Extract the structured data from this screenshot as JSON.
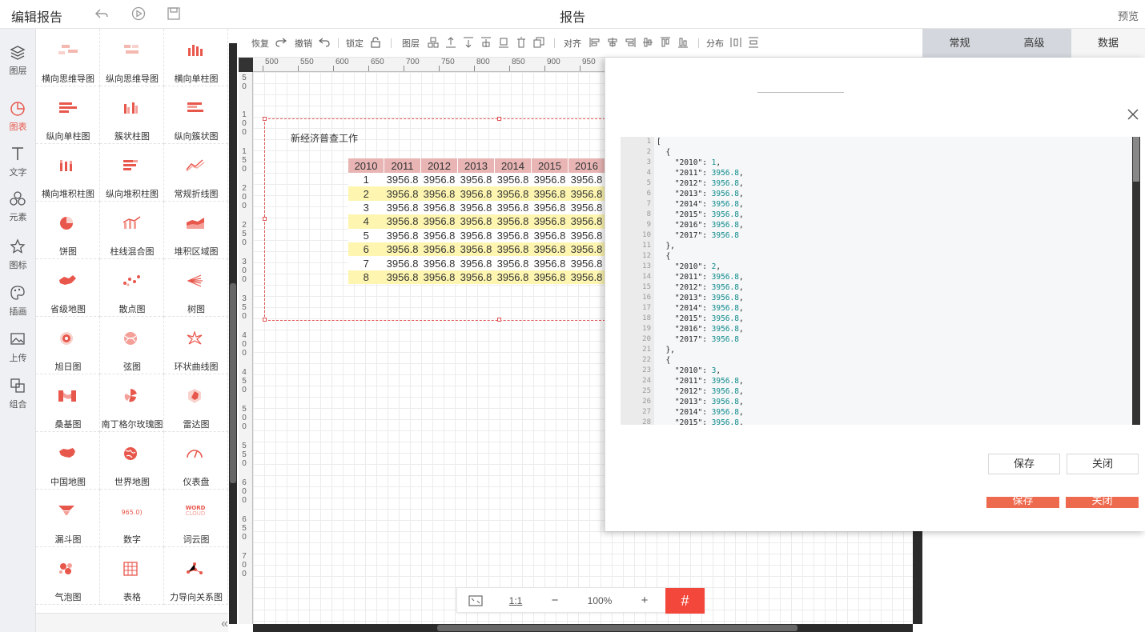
{
  "header": {
    "title": "编辑报告",
    "center_title": "报告",
    "preview_label": "预览"
  },
  "leftnav": [
    {
      "label": "图层",
      "icon": "layers-icon"
    },
    {
      "label": "图表",
      "icon": "chart-pie-icon"
    },
    {
      "label": "文字",
      "icon": "text-icon"
    },
    {
      "label": "元素",
      "icon": "elements-icon"
    },
    {
      "label": "图标",
      "icon": "star-icon"
    },
    {
      "label": "插画",
      "icon": "palette-icon"
    },
    {
      "label": "上传",
      "icon": "upload-image-icon"
    },
    {
      "label": "组合",
      "icon": "group-icon"
    }
  ],
  "palette": [
    "横向思维导图",
    "纵向思维导图",
    "横向单柱图",
    "纵向单柱图",
    "簇状柱图",
    "纵向簇状图",
    "横向堆积柱图",
    "纵向堆积柱图",
    "常规折线图",
    "饼图",
    "柱线混合图",
    "堆积区域图",
    "省级地图",
    "散点图",
    "树图",
    "旭日图",
    "弦图",
    "环状曲线图",
    "桑基图",
    "南丁格尔玫瑰图",
    "雷达图",
    "中国地图",
    "世界地图",
    "仪表盘",
    "漏斗图",
    "数字",
    "词云图",
    "气泡图",
    "表格",
    "力导向关系图"
  ],
  "toolbar": {
    "redo": "恢复",
    "undo": "撤销",
    "lock": "锁定",
    "layer": "图层",
    "align": "对齐",
    "distribute": "分布"
  },
  "ruler": {
    "top": [
      "500",
      "550",
      "600",
      "650",
      "700",
      "750",
      "800",
      "850",
      "900",
      "950"
    ],
    "left": [
      "50",
      "100",
      "150",
      "200",
      "250",
      "300",
      "350",
      "400",
      "450",
      "500",
      "550",
      "600",
      "650",
      "700"
    ]
  },
  "widget": {
    "title": "新经济普查工作",
    "columns": [
      "2010",
      "2011",
      "2012",
      "2013",
      "2014",
      "2015",
      "2016"
    ],
    "rows": [
      [
        "1",
        "3956.8",
        "3956.8",
        "3956.8",
        "3956.8",
        "3956.8",
        "3956.8"
      ],
      [
        "2",
        "3956.8",
        "3956.8",
        "3956.8",
        "3956.8",
        "3956.8",
        "3956.8"
      ],
      [
        "3",
        "3956.8",
        "3956.8",
        "3956.8",
        "3956.8",
        "3956.8",
        "3956.8"
      ],
      [
        "4",
        "3956.8",
        "3956.8",
        "3956.8",
        "3956.8",
        "3956.8",
        "3956.8"
      ],
      [
        "5",
        "3956.8",
        "3956.8",
        "3956.8",
        "3956.8",
        "3956.8",
        "3956.8"
      ],
      [
        "6",
        "3956.8",
        "3956.8",
        "3956.8",
        "3956.8",
        "3956.8",
        "3956.8"
      ],
      [
        "7",
        "3956.8",
        "3956.8",
        "3956.8",
        "3956.8",
        "3956.8",
        "3956.8"
      ],
      [
        "8",
        "3956.8",
        "3956.8",
        "3956.8",
        "3956.8",
        "3956.8",
        "3956.8"
      ]
    ]
  },
  "zoombar": {
    "ratio": "1:1",
    "minus": "−",
    "zoom": "100%",
    "plus": "+"
  },
  "right_tabs": [
    {
      "label": "常规"
    },
    {
      "label": "高级"
    },
    {
      "label": "数据"
    }
  ],
  "editor": {
    "lines": [
      [
        "1",
        "["
      ],
      [
        "2",
        "  {"
      ],
      [
        "3",
        "    \"2010\": ",
        "1",
        ","
      ],
      [
        "4",
        "    \"2011\": ",
        "3956.8",
        ","
      ],
      [
        "5",
        "    \"2012\": ",
        "3956.8",
        ","
      ],
      [
        "6",
        "    \"2013\": ",
        "3956.8",
        ","
      ],
      [
        "7",
        "    \"2014\": ",
        "3956.8",
        ","
      ],
      [
        "8",
        "    \"2015\": ",
        "3956.8",
        ","
      ],
      [
        "9",
        "    \"2016\": ",
        "3956.8",
        ","
      ],
      [
        "10",
        "    \"2017\": ",
        "3956.8",
        ""
      ],
      [
        "11",
        "  },"
      ],
      [
        "12",
        "  {"
      ],
      [
        "13",
        "    \"2010\": ",
        "2",
        ","
      ],
      [
        "14",
        "    \"2011\": ",
        "3956.8",
        ","
      ],
      [
        "15",
        "    \"2012\": ",
        "3956.8",
        ","
      ],
      [
        "16",
        "    \"2013\": ",
        "3956.8",
        ","
      ],
      [
        "17",
        "    \"2014\": ",
        "3956.8",
        ","
      ],
      [
        "18",
        "    \"2015\": ",
        "3956.8",
        ","
      ],
      [
        "19",
        "    \"2016\": ",
        "3956.8",
        ","
      ],
      [
        "20",
        "    \"2017\": ",
        "3956.8",
        ""
      ],
      [
        "21",
        "  },"
      ],
      [
        "22",
        "  {"
      ],
      [
        "23",
        "    \"2010\": ",
        "3",
        ","
      ],
      [
        "24",
        "    \"2011\": ",
        "3956.8",
        ","
      ],
      [
        "25",
        "    \"2012\": ",
        "3956.8",
        ","
      ],
      [
        "26",
        "    \"2013\": ",
        "3956.8",
        ","
      ],
      [
        "27",
        "    \"2014\": ",
        "3956.8",
        ","
      ],
      [
        "28",
        "    \"2015\": ",
        "3956.8",
        ","
      ]
    ]
  },
  "dialog": {
    "save_label": "保存",
    "close_label": "关闭"
  },
  "colors": {
    "accent": "#f2473a",
    "chart_red": "#e8574c",
    "header_row": "#e8b4b4",
    "stripe": "#fdf5b0"
  }
}
